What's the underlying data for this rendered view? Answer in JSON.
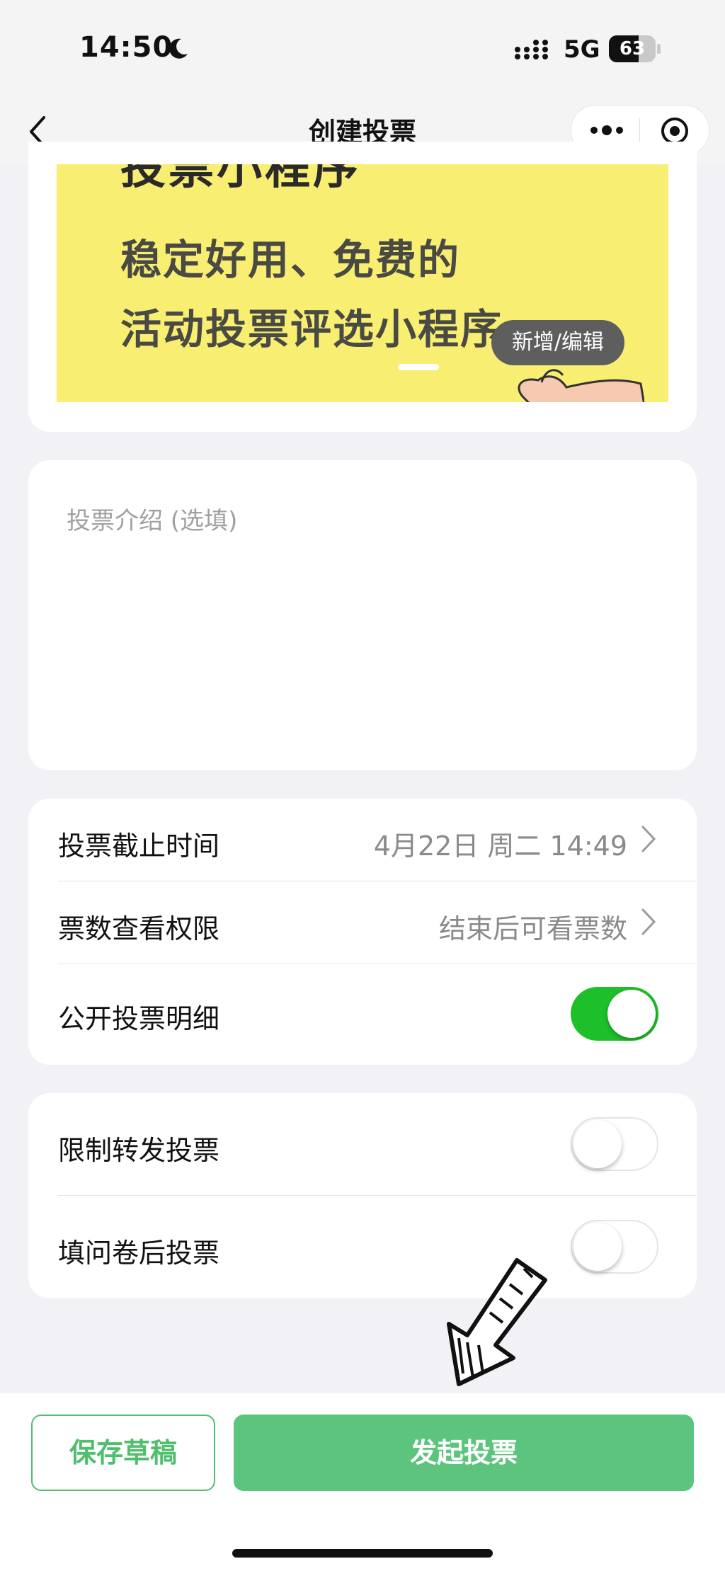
{
  "status_bar": {
    "time": "14:50",
    "network": "5G",
    "battery": "63",
    "battery_level": 0.63
  },
  "nav": {
    "title": "创建投票"
  },
  "banner": {
    "top_text": "投票小程序",
    "line1": "稳定好用、免费的",
    "line2": "活动投票评选小程序",
    "edit_label": "新增/编辑"
  },
  "intro": {
    "placeholder": "投票介绍 (选填)",
    "value": ""
  },
  "settings": {
    "deadline_label": "投票截止时间",
    "deadline_value": "4月22日 周二 14:49",
    "visibility_label": "票数查看权限",
    "visibility_value": "结束后可看票数",
    "public_detail_label": "公开投票明细",
    "public_detail_on": true
  },
  "options": {
    "limit_forward_label": "限制转发投票",
    "limit_forward_on": false,
    "survey_first_label": "填问卷后投票",
    "survey_first_on": false
  },
  "bottom": {
    "draft_label": "保存草稿",
    "publish_label": "发起投票"
  },
  "colors": {
    "accent": "#5cc47c",
    "toggle_on": "#1ec02a",
    "banner_bg": "#f8ef72"
  }
}
